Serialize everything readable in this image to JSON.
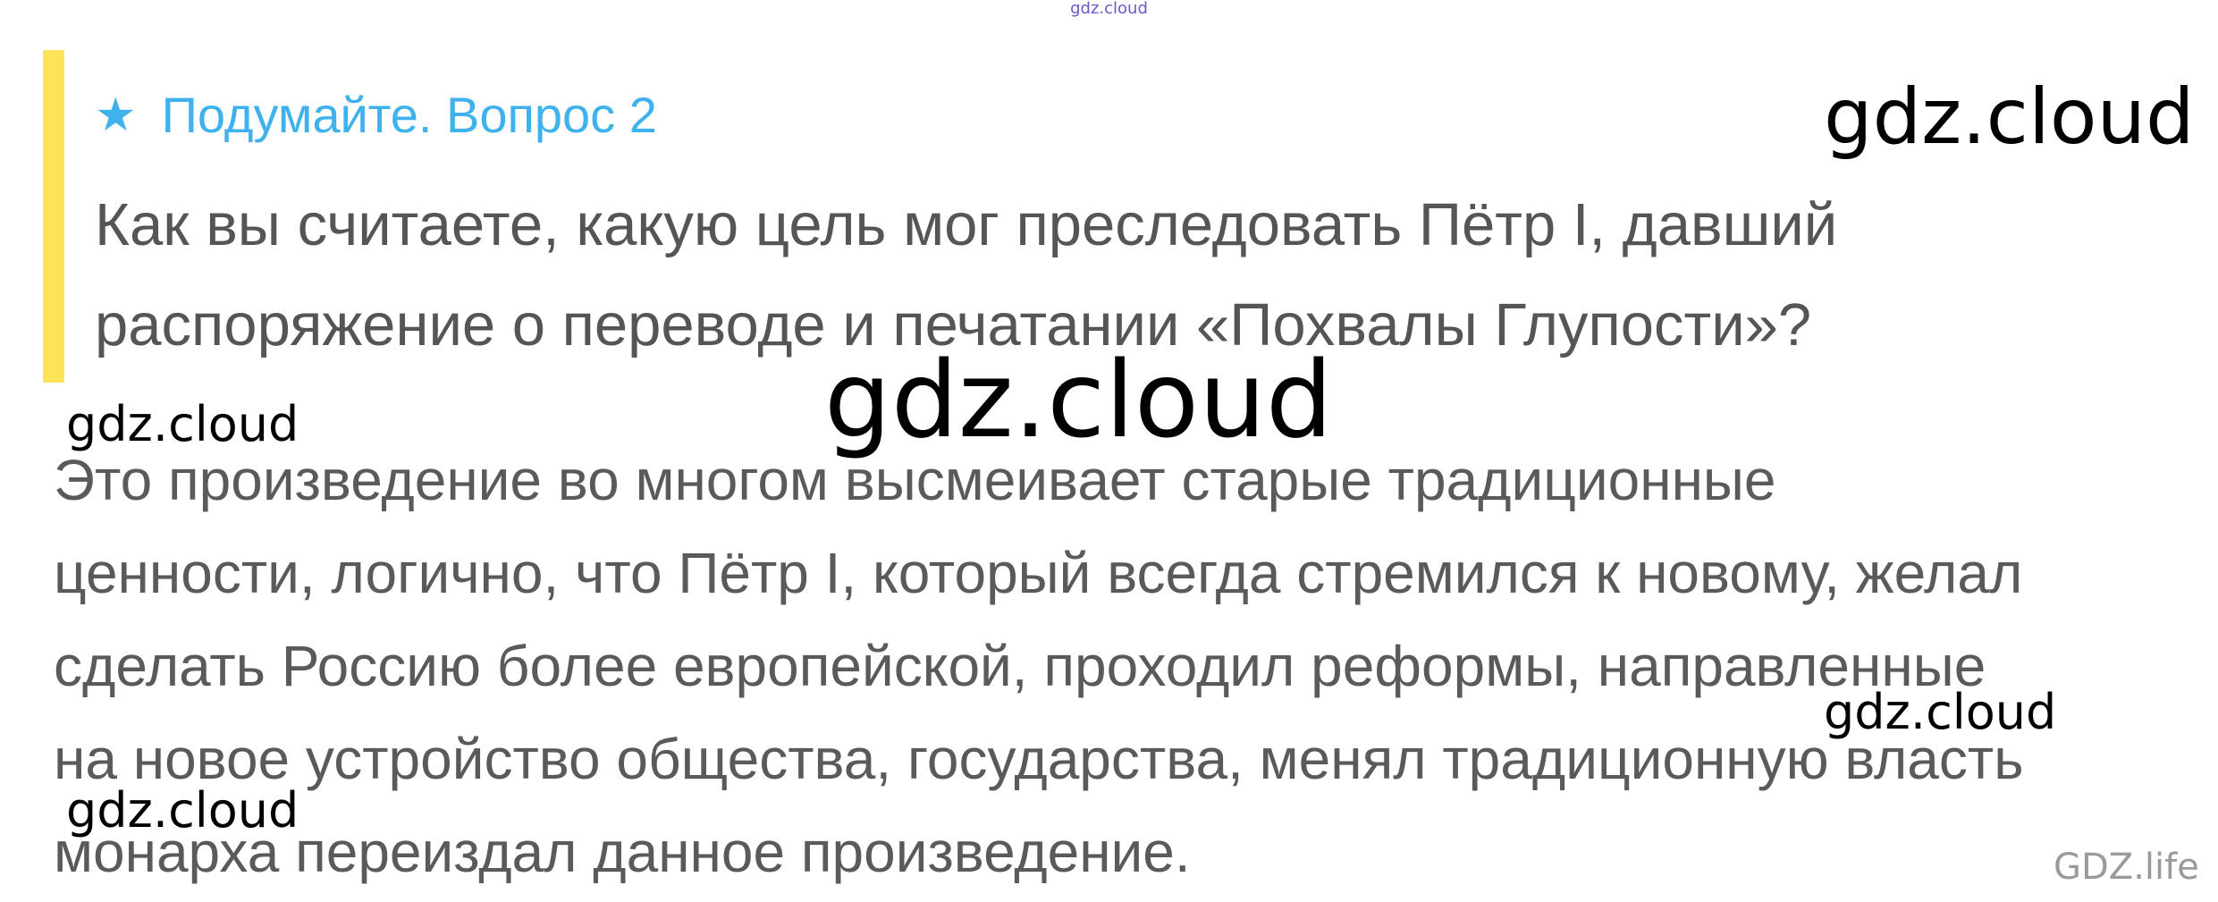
{
  "top_mark": "gdz.cloud",
  "question": {
    "heading": "Подумайте. Вопрос 2",
    "star_icon": "★",
    "lines": [
      "Как вы считаете, какую цель мог преследовать Пётр I, давший",
      "распоряжение о переводе и печатании «Похвалы Глупости»?"
    ]
  },
  "answer": {
    "lines": [
      "Это произведение во многом высмеивает старые традиционные",
      "ценности, логично, что Пётр I, который всегда стремился к новому, желал",
      "сделать Россию более европейской, проходил реформы, направленные",
      "на новое устройство общества, государства, менял традиционную власть",
      "монарха переиздал данное произведение."
    ]
  },
  "watermarks": {
    "top_right": "gdz.cloud",
    "center": "gdz.cloud",
    "left_1": "gdz.cloud",
    "right_2": "gdz.cloud",
    "left_2": "gdz.cloud"
  },
  "footer_mark": "GDZ.life",
  "colors": {
    "accent_bar": "#fde35a",
    "heading": "#3fb1ec",
    "text": "#555555"
  }
}
